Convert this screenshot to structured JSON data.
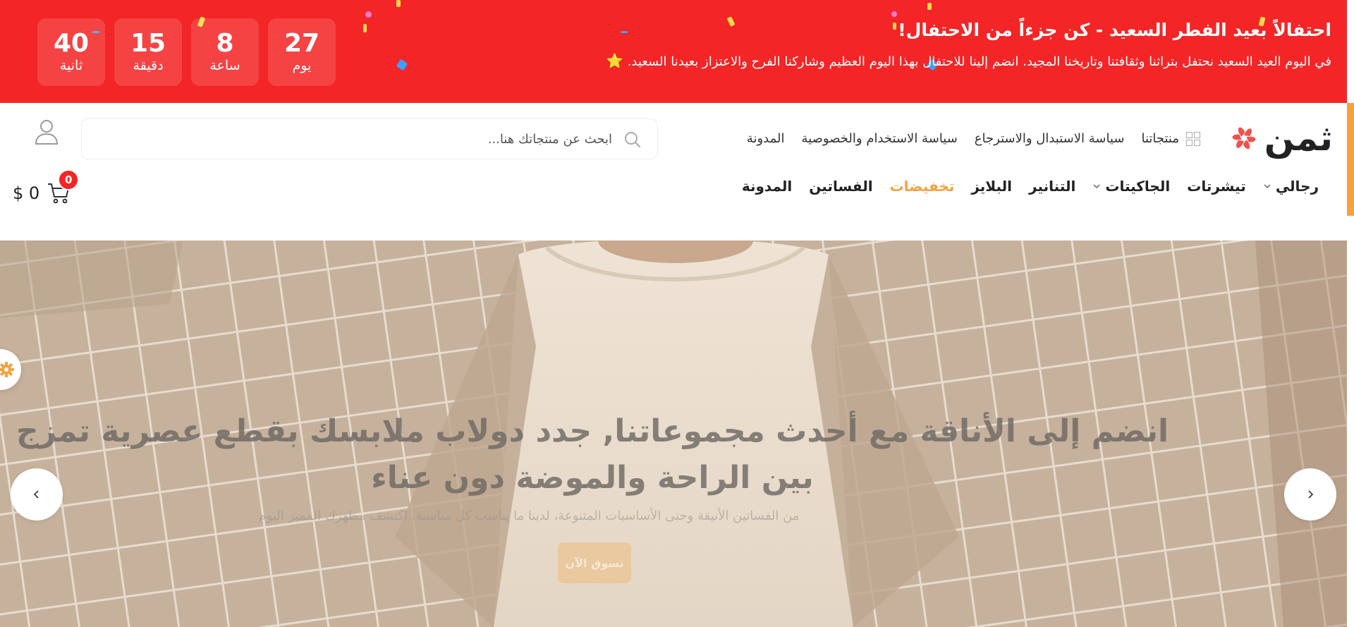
{
  "promo": {
    "title": "احتفالاً بعيد الفطر السعيد - كن جزءاً من الاحتفال!",
    "text": "في اليوم العيد السعيد نحتفل بتراثنا وثقافتنا وتاريخنا المجيد. انضم إلينا للاحتفال بهذا اليوم العظيم وشاركنا الفرح والاعتزاز بعيدنا السعيد.",
    "star_icon": "⭐",
    "countdown": [
      {
        "value": "40",
        "label": "ثانية"
      },
      {
        "value": "15",
        "label": "دقيقة"
      },
      {
        "value": "8",
        "label": "ساعة"
      },
      {
        "value": "27",
        "label": "يوم"
      }
    ],
    "background_color": "#f42526"
  },
  "header": {
    "logo_text": "ثمن",
    "top_nav": [
      "المدونة",
      "سياسة الاستخدام والخصوصية",
      "سياسة الاستبدال والاسترجاع"
    ],
    "products_label": "منتجاتنا",
    "search": {
      "placeholder": "ابحث عن منتجاتك هنا..."
    },
    "main_nav": [
      "المدونة",
      "الفساتين",
      "تخفيضات",
      "البلايز",
      "التنانير",
      "الجاكيتات",
      "تيشرتات",
      "رجالي"
    ],
    "cart": {
      "count": "0",
      "price": "$ 0"
    },
    "accent_color": "#f5a23d"
  },
  "hero": {
    "title_line1": "انضم إلى الأناقة مع أحدث مجموعاتنا, جدد دولاب ملابسك بقطع عصرية تمزج",
    "title_line2": "بين الراحة والموضة دون عناء",
    "subtitle": "من الفساتين الأنيقة وحتى الأساسيات المتنوعة، لدينا ما يناسب كل مناسبة. اكتشف مظهرك المميز اليوم",
    "button_label": "تسوق الآن"
  }
}
